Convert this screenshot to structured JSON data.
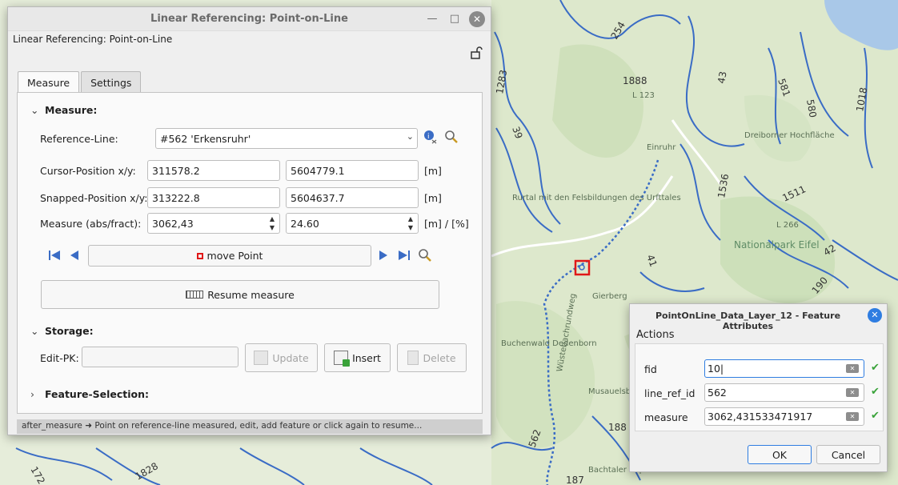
{
  "map": {
    "labels": [
      "254",
      "1888",
      "43",
      "581",
      "580",
      "1018",
      "1283",
      "39",
      "L 123",
      "1536",
      "1511",
      "Nationalpark Eifel",
      "41",
      "42",
      "190",
      "562",
      "188",
      "187",
      "172",
      "1828",
      "L 266"
    ],
    "places": [
      "Einruhr",
      "Dreiborner Hochfläche",
      "Rurtal mit den Felsbildungen des Urfttales",
      "Gierberg",
      "Buchenwald Dedenborn",
      "Wüstebachrundweg",
      "Musauelsberg",
      "Bachtaler Kapellenbursstraße"
    ]
  },
  "main_dialog": {
    "title": "Linear Referencing: Point-on-Line",
    "subtitle": "Linear Referencing: Point-on-Line",
    "tabs": [
      "Measure",
      "Settings"
    ],
    "measure_group": "Measure:",
    "reference_line_label": "Reference-Line:",
    "reference_line_value": "#562 'Erkensruhr'",
    "cursor_label": "Cursor-Position x/y:",
    "cursor_x": "311578.2",
    "cursor_y": "5604779.1",
    "cursor_unit": "[m]",
    "snapped_label": "Snapped-Position x/y:",
    "snapped_x": "313222.8",
    "snapped_y": "5604637.7",
    "snapped_unit": "[m]",
    "measure_label": "Measure (abs/fract):",
    "measure_abs": "3062,43",
    "measure_fract": "24.60",
    "measure_unit": "[m]  / [%]",
    "move_point_label": "move Point",
    "resume_label": "Resume measure",
    "storage_group": "Storage:",
    "edit_pk_label": "Edit-PK:",
    "edit_pk_value": "",
    "update_label": "Update",
    "insert_label": "Insert",
    "delete_label": "Delete",
    "feature_selection_group": "Feature-Selection:",
    "status": "after_measure ➜ Point on reference-line measured, edit, add feature or click again to resume..."
  },
  "attr_dialog": {
    "title": "PointOnLine_Data_Layer_12 - Feature Attributes",
    "menu_actions": "Actions",
    "fields": [
      {
        "label": "fid",
        "value": "10"
      },
      {
        "label": "line_ref_id",
        "value": "562"
      },
      {
        "label": "measure",
        "value": "3062,431533471917"
      }
    ],
    "ok_label": "OK",
    "cancel_label": "Cancel"
  },
  "colors": {
    "accent": "#2f7de1",
    "marker": "#e01818",
    "ok_check": "#3aa33a"
  }
}
